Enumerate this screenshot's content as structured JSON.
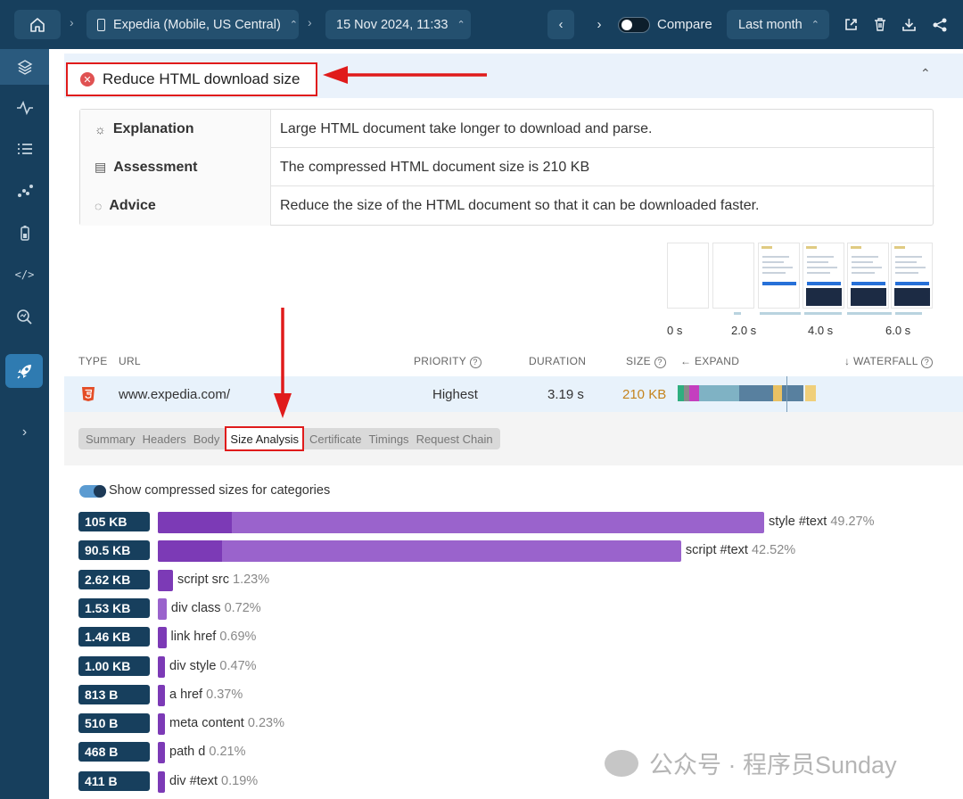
{
  "topbar": {
    "site": "Expedia (Mobile, US Central)",
    "date": "15 Nov 2024, 11:33",
    "compare_label": "Compare",
    "range": "Last month"
  },
  "issue": {
    "title": "Reduce HTML download size"
  },
  "info": {
    "explanation_key": "Explanation",
    "explanation_val": "Large HTML document take longer to download and parse.",
    "assessment_key": "Assessment",
    "assessment_val": "The compressed HTML document size is 210 KB",
    "advice_key": "Advice",
    "advice_val": "Reduce the size of the HTML document so that it can be downloaded faster."
  },
  "filmstrip": {
    "ticks": [
      "0 s",
      "2.0 s",
      "4.0 s",
      "6.0 s"
    ]
  },
  "table": {
    "headers": {
      "type": "TYPE",
      "url": "URL",
      "priority": "PRIORITY",
      "duration": "DURATION",
      "size": "SIZE",
      "expand": "EXPAND",
      "waterfall": "WATERFALL"
    },
    "row": {
      "type_icon": "html5-icon",
      "url": "www.expedia.com/",
      "priority": "Highest",
      "duration": "3.19 s",
      "size": "210 KB"
    }
  },
  "tabs": [
    "Summary",
    "Headers",
    "Body",
    "Size Analysis",
    "Certificate",
    "Timings",
    "Request Chain"
  ],
  "active_tab": "Size Analysis",
  "size_analysis": {
    "toggle_label": "Show compressed sizes for categories",
    "rows": [
      {
        "size": "105 KB",
        "label": "style #text",
        "pct": "49.27%",
        "fraction": 0.4927
      },
      {
        "size": "90.5 KB",
        "label": "script #text",
        "pct": "42.52%",
        "fraction": 0.4252
      },
      {
        "size": "2.62 KB",
        "label": "script src",
        "pct": "1.23%",
        "fraction": 0.0123
      },
      {
        "size": "1.53 KB",
        "label": "div class",
        "pct": "0.72%",
        "fraction": 0.0072
      },
      {
        "size": "1.46 KB",
        "label": "link href",
        "pct": "0.69%",
        "fraction": 0.0069
      },
      {
        "size": "1.00 KB",
        "label": "div style",
        "pct": "0.47%",
        "fraction": 0.0047
      },
      {
        "size": "813 B",
        "label": "a href",
        "pct": "0.37%",
        "fraction": 0.0037
      },
      {
        "size": "510 B",
        "label": "meta content",
        "pct": "0.23%",
        "fraction": 0.0023
      },
      {
        "size": "468 B",
        "label": "path d",
        "pct": "0.21%",
        "fraction": 0.0021
      },
      {
        "size": "411 B",
        "label": "div #text",
        "pct": "0.19%",
        "fraction": 0.0019
      }
    ]
  },
  "watermark": "公众号 · 程序员Sunday",
  "colors": {
    "nav": "#173f5d",
    "accent": "#2f7bb1",
    "bar": "#9a63cc",
    "bar_dark": "#7c3ab6",
    "annotation": "#e01b1b",
    "size_text": "#c4841d"
  }
}
